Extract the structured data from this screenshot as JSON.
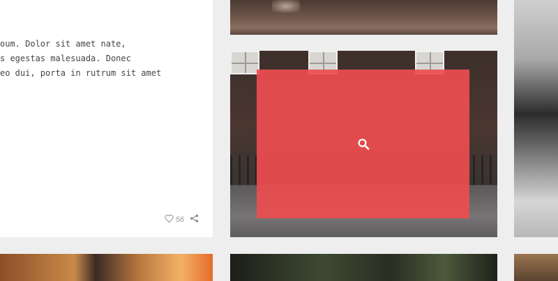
{
  "post": {
    "excerpt_lines": [
      "oum. Dolor sit amet nate,",
      "s egestas malesuada. Donec",
      "eo dui, porta in rutrum sit amet"
    ],
    "like_count": "56",
    "like_icon": "heart-outline-icon",
    "share_icon": "share-icon"
  },
  "hover_overlay": {
    "icon": "search-icon",
    "color": "#EC4E50"
  }
}
